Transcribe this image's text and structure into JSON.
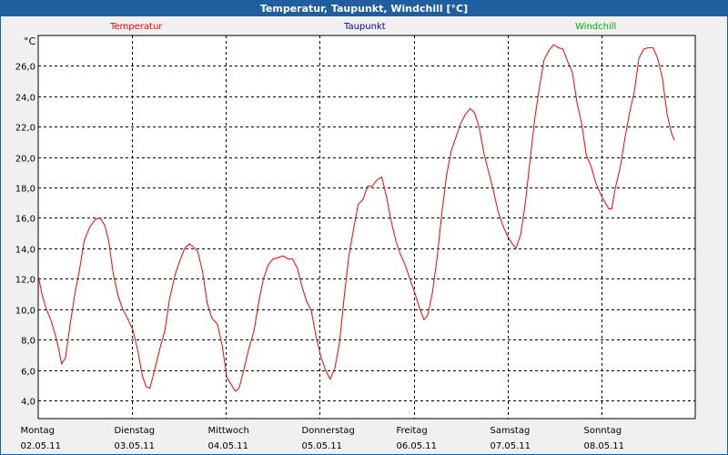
{
  "window": {
    "title": "Temperatur, Taupunkt, Windchill [°C]"
  },
  "legend": [
    {
      "label": "Temperatur",
      "color": "#ff0000"
    },
    {
      "label": "Taupunkt",
      "color": "#0000c0"
    },
    {
      "label": "Windchill",
      "color": "#00b000"
    }
  ],
  "chart_data": {
    "type": "line",
    "title": "Temperatur, Taupunkt, Windchill [°C]",
    "unit": "°C",
    "ylim": [
      2.8,
      28.0
    ],
    "yticks": [
      "4,0",
      "6,0",
      "8,0",
      "10,0",
      "12,0",
      "14,0",
      "16,0",
      "18,0",
      "20,0",
      "22,0",
      "24,0",
      "26,0"
    ],
    "ytick_values": [
      4,
      6,
      8,
      10,
      12,
      14,
      16,
      18,
      20,
      22,
      24,
      26
    ],
    "xlim": [
      0,
      7.0
    ],
    "xticks": [
      {
        "day": "Montag",
        "date": "02.05.11",
        "x": 0
      },
      {
        "day": "Dienstag",
        "date": "03.05.11",
        "x": 1
      },
      {
        "day": "Mittwoch",
        "date": "04.05.11",
        "x": 2
      },
      {
        "day": "Donnerstag",
        "date": "05.05.11",
        "x": 3
      },
      {
        "day": "Freitag",
        "date": "06.05.11",
        "x": 4
      },
      {
        "day": "Samstag",
        "date": "07.05.11",
        "x": 5
      },
      {
        "day": "Sonntag",
        "date": "08.05.11",
        "x": 6
      }
    ],
    "grid": true,
    "legend_placement": "top",
    "series": [
      {
        "name": "Temperatur",
        "color": "#ff0000",
        "points": [
          [
            0.0,
            12.2
          ],
          [
            0.04,
            11.0
          ],
          [
            0.08,
            10.1
          ],
          [
            0.14,
            9.2
          ],
          [
            0.2,
            7.9
          ],
          [
            0.25,
            6.4
          ],
          [
            0.29,
            6.8
          ],
          [
            0.34,
            9.0
          ],
          [
            0.39,
            11.0
          ],
          [
            0.44,
            12.6
          ],
          [
            0.49,
            14.5
          ],
          [
            0.55,
            15.4
          ],
          [
            0.61,
            15.9
          ],
          [
            0.66,
            16.0
          ],
          [
            0.71,
            15.5
          ],
          [
            0.75,
            14.5
          ],
          [
            0.8,
            12.3
          ],
          [
            0.85,
            10.9
          ],
          [
            0.9,
            10.0
          ],
          [
            0.95,
            9.4
          ],
          [
            1.01,
            8.6
          ],
          [
            1.06,
            7.3
          ],
          [
            1.11,
            5.6
          ],
          [
            1.15,
            4.9
          ],
          [
            1.19,
            4.8
          ],
          [
            1.24,
            6.0
          ],
          [
            1.3,
            7.5
          ],
          [
            1.35,
            8.6
          ],
          [
            1.4,
            10.7
          ],
          [
            1.46,
            12.3
          ],
          [
            1.51,
            13.2
          ],
          [
            1.56,
            14.0
          ],
          [
            1.61,
            14.3
          ],
          [
            1.65,
            14.1
          ],
          [
            1.7,
            13.8
          ],
          [
            1.75,
            12.5
          ],
          [
            1.8,
            10.4
          ],
          [
            1.85,
            9.4
          ],
          [
            1.91,
            9.0
          ],
          [
            1.96,
            7.6
          ],
          [
            2.01,
            5.5
          ],
          [
            2.06,
            5.0
          ],
          [
            2.1,
            4.6
          ],
          [
            2.14,
            4.8
          ],
          [
            2.19,
            6.0
          ],
          [
            2.24,
            7.3
          ],
          [
            2.3,
            8.6
          ],
          [
            2.35,
            10.5
          ],
          [
            2.4,
            12.0
          ],
          [
            2.45,
            12.9
          ],
          [
            2.5,
            13.3
          ],
          [
            2.56,
            13.4
          ],
          [
            2.61,
            13.5
          ],
          [
            2.66,
            13.3
          ],
          [
            2.71,
            13.3
          ],
          [
            2.76,
            12.7
          ],
          [
            2.81,
            11.5
          ],
          [
            2.86,
            10.5
          ],
          [
            2.91,
            9.9
          ],
          [
            2.96,
            8.2
          ],
          [
            3.01,
            6.9
          ],
          [
            3.06,
            6.0
          ],
          [
            3.11,
            5.4
          ],
          [
            3.16,
            6.1
          ],
          [
            3.21,
            7.8
          ],
          [
            3.26,
            10.8
          ],
          [
            3.31,
            13.5
          ],
          [
            3.36,
            15.3
          ],
          [
            3.41,
            16.9
          ],
          [
            3.46,
            17.2
          ],
          [
            3.51,
            18.1
          ],
          [
            3.56,
            18.1
          ],
          [
            3.61,
            18.5
          ],
          [
            3.66,
            18.7
          ],
          [
            3.71,
            17.4
          ],
          [
            3.76,
            15.8
          ],
          [
            3.81,
            14.5
          ],
          [
            3.86,
            13.6
          ],
          [
            3.91,
            12.9
          ],
          [
            3.96,
            12.0
          ],
          [
            4.01,
            11.1
          ],
          [
            4.06,
            10.1
          ],
          [
            4.11,
            9.3
          ],
          [
            4.15,
            9.6
          ],
          [
            4.2,
            11.1
          ],
          [
            4.25,
            13.4
          ],
          [
            4.3,
            16.3
          ],
          [
            4.35,
            18.8
          ],
          [
            4.4,
            20.4
          ],
          [
            4.45,
            21.3
          ],
          [
            4.5,
            22.2
          ],
          [
            4.55,
            22.8
          ],
          [
            4.6,
            23.2
          ],
          [
            4.65,
            22.9
          ],
          [
            4.7,
            21.9
          ],
          [
            4.75,
            20.2
          ],
          [
            4.8,
            19.0
          ],
          [
            4.85,
            17.8
          ],
          [
            4.9,
            16.4
          ],
          [
            4.95,
            15.5
          ],
          [
            5.0,
            14.8
          ],
          [
            5.05,
            14.3
          ],
          [
            5.09,
            14.0
          ],
          [
            5.14,
            14.9
          ],
          [
            5.19,
            17.0
          ],
          [
            5.24,
            19.8
          ],
          [
            5.29,
            22.5
          ],
          [
            5.34,
            24.6
          ],
          [
            5.39,
            26.4
          ],
          [
            5.44,
            27.0
          ],
          [
            5.49,
            27.4
          ],
          [
            5.54,
            27.2
          ],
          [
            5.59,
            27.1
          ],
          [
            5.64,
            26.3
          ],
          [
            5.69,
            25.6
          ],
          [
            5.74,
            23.6
          ],
          [
            5.79,
            22.2
          ],
          [
            5.84,
            20.1
          ],
          [
            5.89,
            19.4
          ],
          [
            5.94,
            18.3
          ],
          [
            5.99,
            17.6
          ],
          [
            6.04,
            17.0
          ],
          [
            6.08,
            16.6
          ],
          [
            6.11,
            16.6
          ],
          [
            6.15,
            18.0
          ],
          [
            6.2,
            19.3
          ],
          [
            6.25,
            21.2
          ],
          [
            6.3,
            22.9
          ],
          [
            6.35,
            24.3
          ],
          [
            6.4,
            26.5
          ],
          [
            6.45,
            27.1
          ],
          [
            6.5,
            27.2
          ],
          [
            6.55,
            27.2
          ],
          [
            6.6,
            26.5
          ],
          [
            6.65,
            25.2
          ],
          [
            6.7,
            22.8
          ],
          [
            6.75,
            21.5
          ],
          [
            6.78,
            21.1
          ]
        ]
      }
    ]
  }
}
